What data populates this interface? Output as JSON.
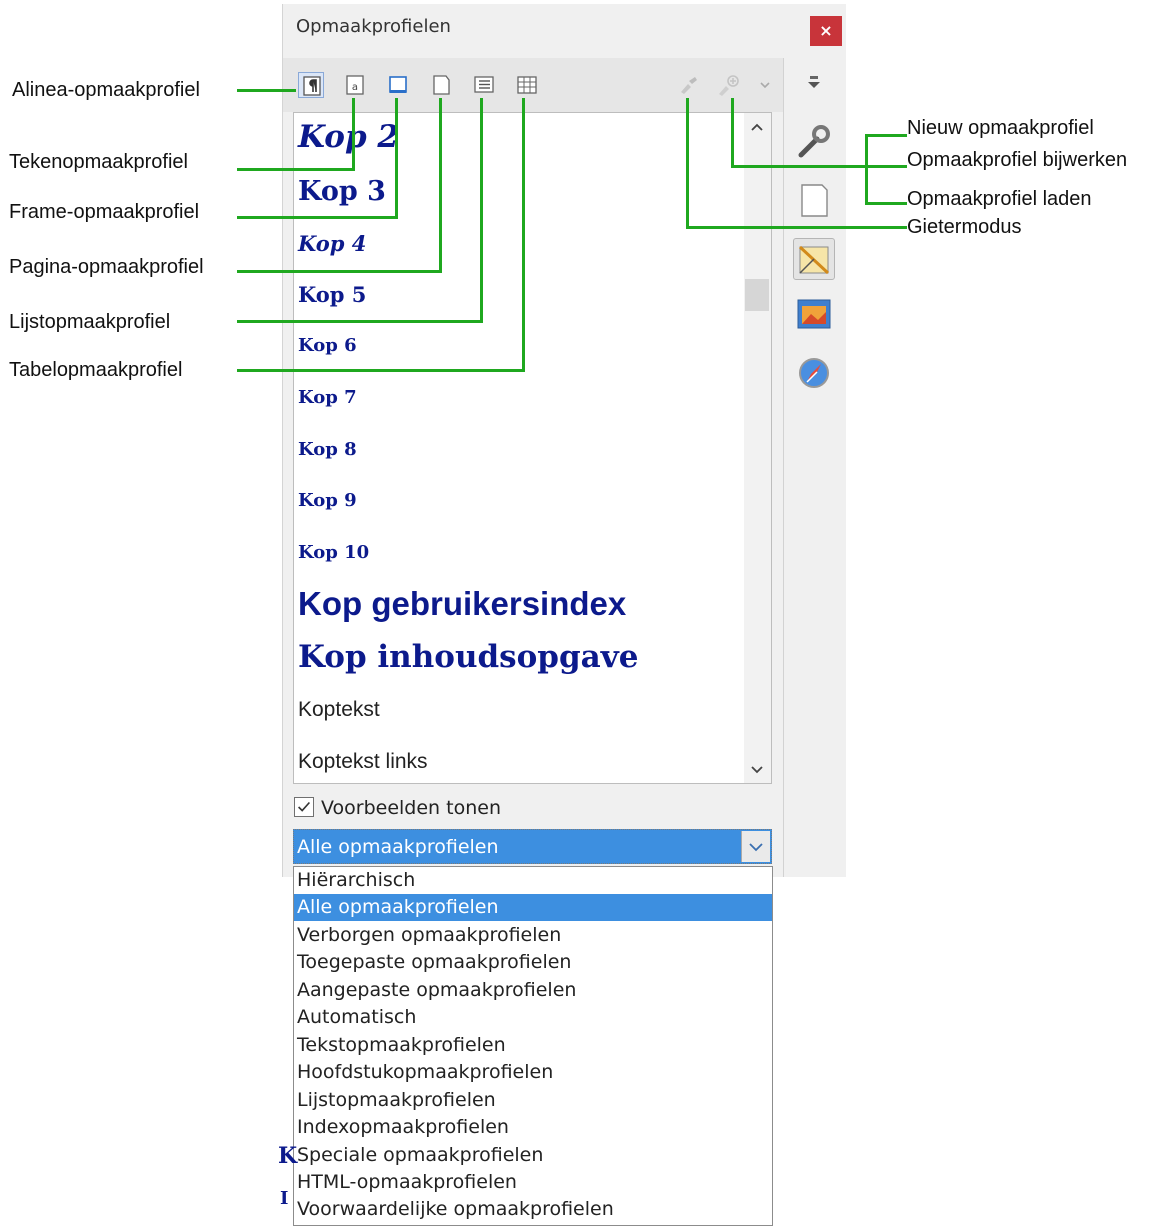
{
  "panel": {
    "title": "Opmaakprofielen",
    "close_label": "×"
  },
  "style_list": {
    "items": [
      {
        "label": "Kop 2",
        "kind": "heading"
      },
      {
        "label": "Kop 3",
        "kind": "heading"
      },
      {
        "label": "Kop 4",
        "kind": "heading"
      },
      {
        "label": "Kop 5",
        "kind": "heading"
      },
      {
        "label": "Kop 6",
        "kind": "heading"
      },
      {
        "label": "Kop 7",
        "kind": "heading"
      },
      {
        "label": "Kop 8",
        "kind": "heading"
      },
      {
        "label": "Kop 9",
        "kind": "heading"
      },
      {
        "label": "Kop 10",
        "kind": "heading"
      },
      {
        "label": "Kop gebruikersindex",
        "kind": "heading"
      },
      {
        "label": "Kop inhoudsopgave",
        "kind": "heading"
      },
      {
        "label": "Koptekst",
        "kind": "plain"
      },
      {
        "label": "Koptekst links",
        "kind": "plain"
      }
    ]
  },
  "preview": {
    "label": "Voorbeelden tonen",
    "checked": true
  },
  "filter": {
    "selected": "Alle opmaakprofielen",
    "options": [
      "Hiërarchisch",
      "Alle opmaakprofielen",
      "Verborgen opmaakprofielen",
      "Toegepaste opmaakprofielen",
      "Aangepaste opmaakprofielen",
      "Automatisch",
      "Tekstopmaakprofielen",
      "Hoofdstukopmaakprofielen",
      "Lijstopmaakprofielen",
      "Indexopmaakprofielen",
      "Speciale opmaakprofielen",
      "HTML-opmaakprofielen",
      "Voorwaardelijke opmaakprofielen"
    ]
  },
  "callouts": {
    "left": [
      "Alinea-opmaakprofiel",
      "Tekenopmaakprofiel",
      "Frame-opmaakprofiel",
      "Pagina-opmaakprofiel",
      "Lijstopmaakprofiel",
      "Tabelopmaakprofiel"
    ],
    "right": [
      "Nieuw opmaakprofiel",
      "Opmaakprofiel bijwerken",
      "Opmaakprofiel laden",
      "Gietermodus"
    ]
  },
  "toolbar_icons": [
    "paragraph-styles-icon",
    "character-styles-icon",
    "frame-styles-icon",
    "page-styles-icon",
    "list-styles-icon",
    "table-styles-icon",
    "fill-format-mode-icon",
    "new-style-icon",
    "menu-chevron-icon"
  ],
  "deck_icons": [
    "deck-menu-icon",
    "properties-icon",
    "page-icon",
    "styles-icon",
    "gallery-icon",
    "navigator-icon"
  ],
  "colors": {
    "heading": "#0c1a8c",
    "selection": "#3d8fe0",
    "callout_line": "#1fa81f",
    "close": "#c8343a"
  }
}
